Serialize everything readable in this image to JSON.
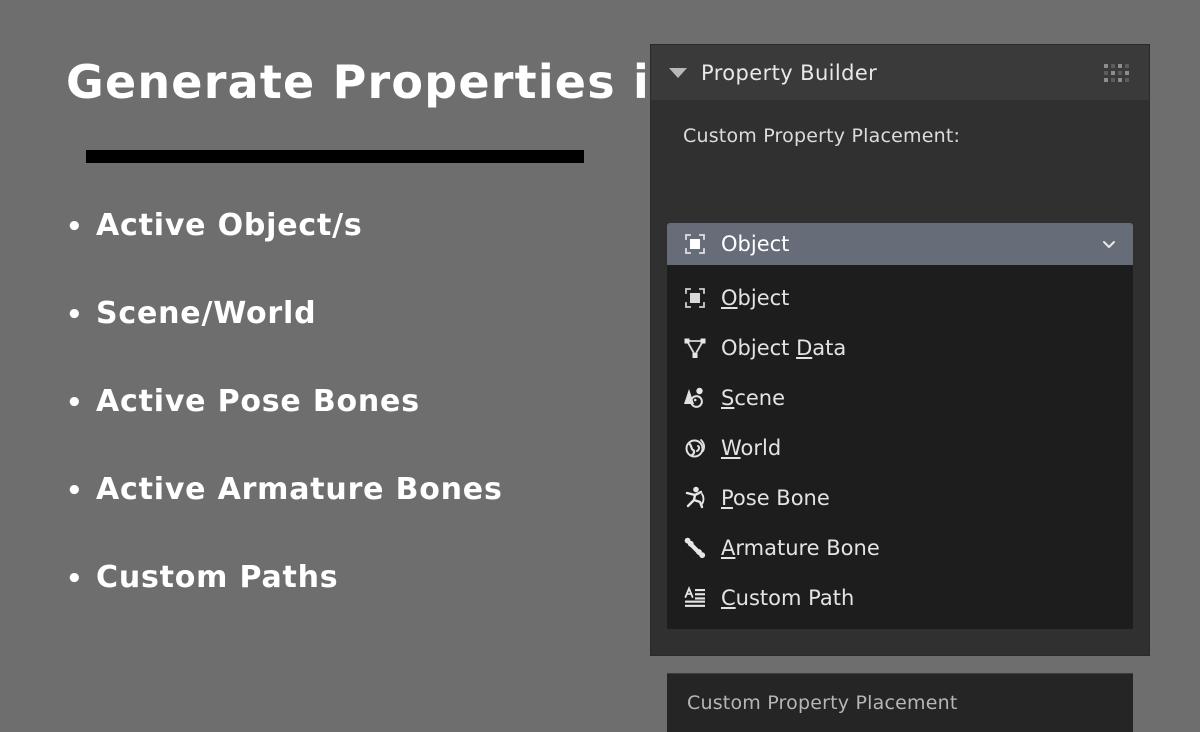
{
  "slide": {
    "title": "Generate Properties in",
    "bullets": [
      {
        "text": "Active Object/s",
        "marker": "•"
      },
      {
        "text": "Scene/World",
        "marker": "•"
      },
      {
        "text": "Active Pose Bones",
        "marker": "•"
      },
      {
        "text": "Active Armature Bones",
        "marker": "•"
      },
      {
        "text": "Custom Paths",
        "marker": "•"
      }
    ]
  },
  "panel": {
    "title": "Property Builder",
    "disclosure_state": "expanded",
    "field_label": "Custom Property Placement:",
    "combo": {
      "value": "Object",
      "icon": "object-icon"
    },
    "options": [
      {
        "label": "Object",
        "accel": "O",
        "rest": "bject",
        "icon": "object-icon"
      },
      {
        "label": "Object Data",
        "accel": "D",
        "rest": "",
        "pre": "Object ",
        "post": "ata",
        "icon": "object-data-icon"
      },
      {
        "label": "Scene",
        "accel": "S",
        "rest": "cene",
        "icon": "scene-icon"
      },
      {
        "label": "World",
        "accel": "W",
        "rest": "orld",
        "icon": "world-icon"
      },
      {
        "label": "Pose Bone",
        "accel": "P",
        "rest": "ose Bone",
        "icon": "pose-bone-icon"
      },
      {
        "label": "Armature Bone",
        "accel": "A",
        "rest": "rmature Bone",
        "icon": "armature-bone-icon"
      },
      {
        "label": "Custom Path",
        "accel": "C",
        "rest": "ustom Path",
        "icon": "custom-path-icon"
      }
    ],
    "footer_text": "Custom Property Placement"
  },
  "colors": {
    "slide_background": "#6e6e6e",
    "panel_header": "#3a3a3a",
    "panel_body": "#303030",
    "dropdown_background": "#1d1d1d",
    "highlight": "#676c79",
    "footer": "#252525",
    "text_primary": "#ffffff",
    "text_secondary": "#e3e3e3",
    "rule": "#000000"
  }
}
